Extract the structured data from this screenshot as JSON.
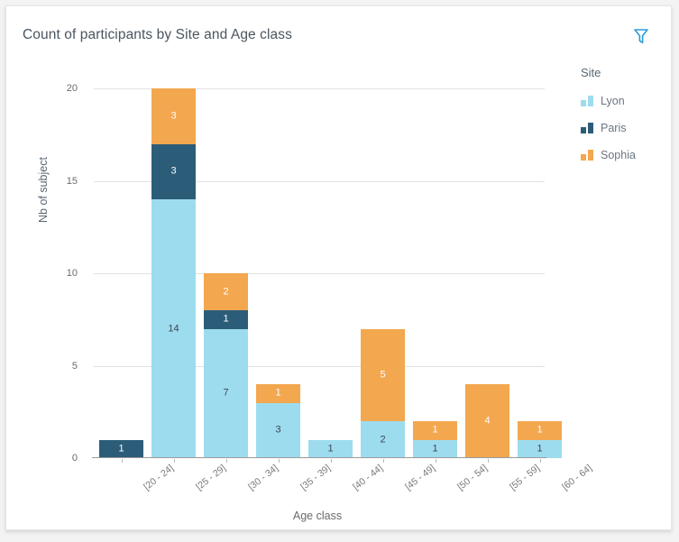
{
  "card": {
    "title": "Count of participants by Site and Age class",
    "filter_icon": "filter-funnel-icon"
  },
  "legend": {
    "title": "Site",
    "items": [
      {
        "label": "Lyon",
        "color": "#9ddcee"
      },
      {
        "label": "Paris",
        "color": "#2b5d79"
      },
      {
        "label": "Sophia",
        "color": "#f3a74f"
      }
    ]
  },
  "chart_data": {
    "type": "bar",
    "title": "Count of participants by Site and Age class",
    "xlabel": "Age class",
    "ylabel": "Nb of subject",
    "ylim": [
      0,
      20
    ],
    "yticks": [
      0,
      5,
      10,
      15,
      20
    ],
    "grid": true,
    "stacked": true,
    "legend_position": "right",
    "legend_title": "Site",
    "categories": [
      "[20 - 24]",
      "[25 - 29]",
      "[30 - 34]",
      "[35 - 39]",
      "[40 - 44]",
      "[45 - 49]",
      "[50 - 54]",
      "[55 - 59]",
      "[60 - 64]"
    ],
    "series": [
      {
        "name": "Lyon",
        "color": "#9ddcee",
        "values": [
          0,
          14,
          7,
          3,
          1,
          2,
          1,
          0,
          1
        ]
      },
      {
        "name": "Paris",
        "color": "#2b5d79",
        "values": [
          1,
          3,
          1,
          0,
          0,
          0,
          0,
          0,
          0
        ]
      },
      {
        "name": "Sophia",
        "color": "#f3a74f",
        "values": [
          0,
          3,
          2,
          1,
          0,
          5,
          1,
          4,
          1
        ]
      }
    ],
    "totals": [
      1,
      20,
      10,
      4,
      1,
      7,
      2,
      4,
      2
    ]
  },
  "colors": {
    "lyon": "#9ddcee",
    "paris": "#2b5d79",
    "sophia": "#f3a74f",
    "filter_icon": "#2e9bd6",
    "card_background": "#ffffff",
    "page_background": "#f3f3f4",
    "axis_text": "#6b6b6b"
  }
}
